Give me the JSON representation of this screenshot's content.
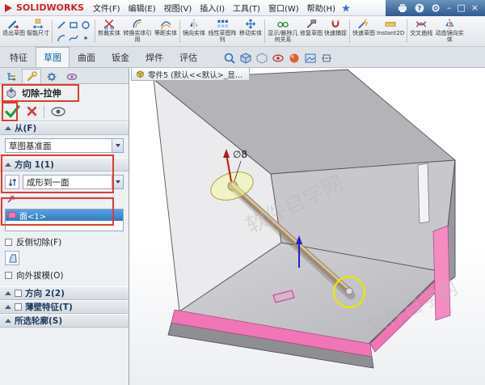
{
  "title_bar": {
    "logo": "SOLIDWORKS",
    "menus": [
      {
        "label": "文件(F)"
      },
      {
        "label": "编辑(E)"
      },
      {
        "label": "视图(V)"
      },
      {
        "label": "插入(I)"
      },
      {
        "label": "工具(T)"
      },
      {
        "label": "窗口(W)"
      },
      {
        "label": "帮助(H)"
      }
    ]
  },
  "toolbar": {
    "items": [
      {
        "label": "退出草图"
      },
      {
        "label": "智能尺寸"
      },
      {
        "label": "剪裁实体"
      },
      {
        "label": "转换实体引用"
      },
      {
        "label": "等距实体"
      },
      {
        "label": "镜向实体"
      },
      {
        "label": "线性草图阵列"
      },
      {
        "label": "移动实体"
      },
      {
        "label": "显示/删除几何关系"
      },
      {
        "label": "修复草图"
      },
      {
        "label": "快速捕捉"
      },
      {
        "label": "快速草图"
      },
      {
        "label": "Instant2D"
      },
      {
        "label": "交叉曲线"
      },
      {
        "label": "动态镜向实体"
      }
    ]
  },
  "command_bar": {
    "tabs": [
      {
        "label": "特征"
      },
      {
        "label": "草图"
      },
      {
        "label": "曲面"
      },
      {
        "label": "钣金"
      },
      {
        "label": "焊件"
      },
      {
        "label": "评估"
      }
    ]
  },
  "property_panel": {
    "title": "切除-拉伸",
    "from_section": {
      "header": "从(F)",
      "value": "草图基准面"
    },
    "direction1": {
      "header": "方向 1(1)",
      "value": "成形到一面",
      "selection": "面<1>",
      "flip_label": "反侧切除(F)",
      "draft_label": "向外拔模(O)"
    },
    "direction2": {
      "header": "方向 2(2)"
    },
    "thin_feature": {
      "header": "薄壁特征(T)"
    },
    "selected_contours": {
      "header": "所选轮廓(S)"
    }
  },
  "viewport": {
    "document_tab": "零件5 (默认<<默认>_显...",
    "dimension_label": "∅8",
    "watermark": "软件自学网"
  },
  "colors": {
    "annotation_red": "#e23b2e",
    "selection_blue": "#2f7cc4",
    "face_pink": "#f176b6",
    "highlight_yellow": "#e8e800"
  }
}
